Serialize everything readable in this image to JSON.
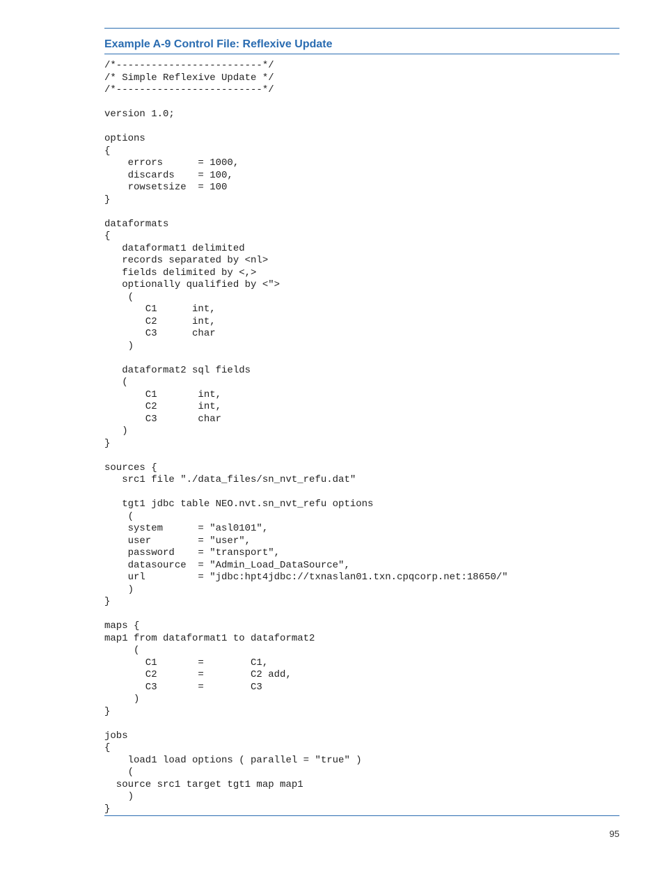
{
  "caption": "Example A-9 Control File: Reflexive Update",
  "code": "/*-------------------------*/\n/* Simple Reflexive Update */\n/*-------------------------*/\n\nversion 1.0;\n\noptions\n{\n    errors      = 1000,\n    discards    = 100,\n    rowsetsize  = 100\n}\n\ndataformats\n{\n   dataformat1 delimited\n   records separated by <nl>\n   fields delimited by <,>\n   optionally qualified by <\">\n    (\n       C1      int,\n       C2      int,\n       C3      char\n    )\n\n   dataformat2 sql fields\n   (\n       C1       int,\n       C2       int,\n       C3       char\n   )\n}\n\nsources {\n   src1 file \"./data_files/sn_nvt_refu.dat\"\n\n   tgt1 jdbc table NEO.nvt.sn_nvt_refu options  \n    (\n    system      = \"asl0101\",\n    user        = \"user\",\n    password    = \"transport\",\n    datasource  = \"Admin_Load_DataSource\",\n    url         = \"jdbc:hpt4jdbc://txnaslan01.txn.cpqcorp.net:18650/\"\n    )\n}\n\nmaps {\nmap1 from dataformat1 to dataformat2\n     (\n       C1       =        C1,\n       C2       =        C2 add,\n       C3       =        C3\n     )\n}\n\njobs\n{\n    load1 load options ( parallel = \"true\" )\n    (\n  source src1 target tgt1 map map1\n    )\n}",
  "page_number": "95"
}
